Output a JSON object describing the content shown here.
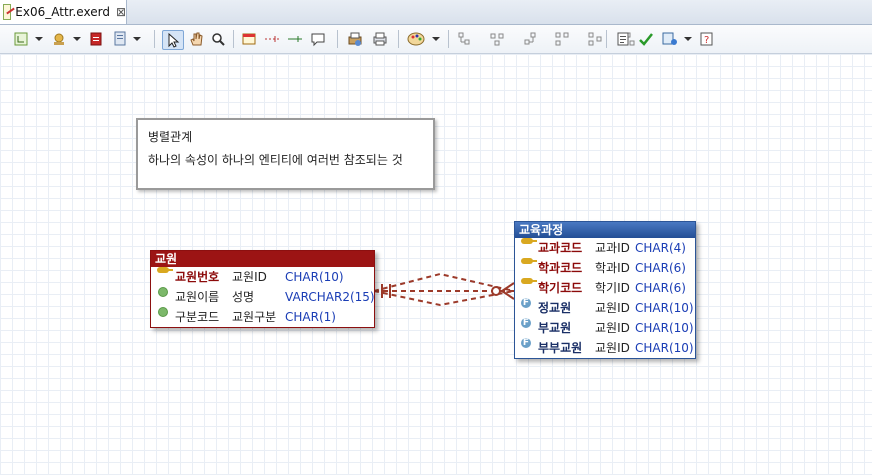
{
  "tab": {
    "title": "Ex06_Attr.exerd",
    "close_glyph": "⊠"
  },
  "note": {
    "line1": "병렬관계",
    "line2": "하나의 속성이 하나의 엔티티에 여러번 참조되는 것"
  },
  "entity_left": {
    "name": "교원",
    "rows": [
      {
        "kind": "pk",
        "logical": "교원번호",
        "physical": "교원ID",
        "type": "CHAR(10)"
      },
      {
        "kind": "attr",
        "logical": "교원이름",
        "physical": "성명",
        "type": "VARCHAR2(15)"
      },
      {
        "kind": "attr",
        "logical": "구분코드",
        "physical": "교원구분",
        "type": "CHAR(1)"
      }
    ]
  },
  "entity_right": {
    "name": "교육과정",
    "rows": [
      {
        "kind": "pk",
        "logical": "교과코드",
        "physical": "교과ID",
        "type": "CHAR(4)"
      },
      {
        "kind": "pk",
        "logical": "학과코드",
        "physical": "학과ID",
        "type": "CHAR(6)"
      },
      {
        "kind": "pk",
        "logical": "학기코드",
        "physical": "학기ID",
        "type": "CHAR(6)"
      },
      {
        "kind": "fk",
        "logical": "정교원",
        "physical": "교원ID",
        "type": "CHAR(10)"
      },
      {
        "kind": "fk",
        "logical": "부교원",
        "physical": "교원ID",
        "type": "CHAR(10)"
      },
      {
        "kind": "fk",
        "logical": "부부교원",
        "physical": "교원ID",
        "type": "CHAR(10)"
      }
    ]
  },
  "icons": [
    "layout-icon",
    "entity-icon",
    "table-icon",
    "page-icon",
    "select-icon",
    "hand-icon",
    "zoom-icon",
    "note-icon",
    "relation-icon",
    "relation2-icon",
    "comment-icon",
    "print-icon",
    "printer-icon",
    "palette-icon",
    "align-icon",
    "check-icon",
    "validate-icon",
    "help-icon"
  ],
  "colors": {
    "entity_left_header": "#9c1414",
    "entity_right_header": "#234e95",
    "relation_line": "#9c3a2a"
  }
}
